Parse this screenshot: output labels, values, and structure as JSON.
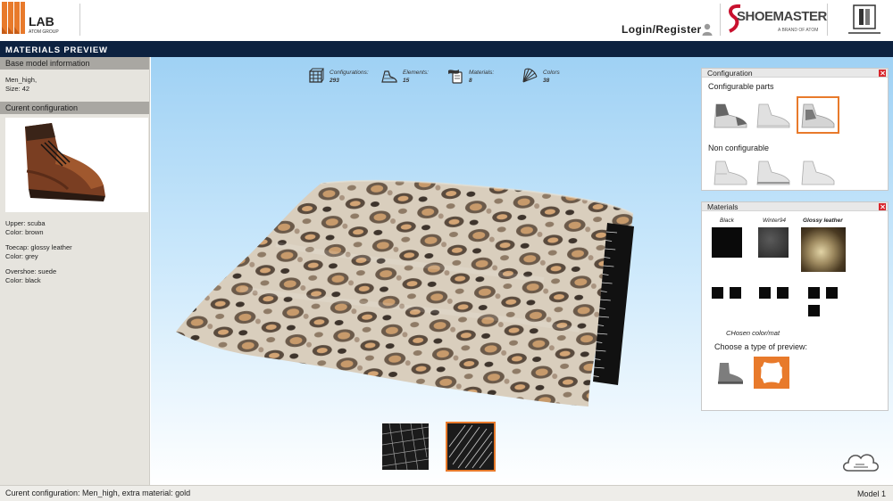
{
  "header": {
    "logo_lab": "LAB",
    "logo_sub": "ATOM GROUP",
    "login_label": "Login/Register",
    "shoemaster_text": "SHOEMASTER",
    "shoemaster_sub": "A BRAND OF ATOM"
  },
  "titlebar": {
    "title": "MATERIALS  PREVIEW"
  },
  "left": {
    "base_header": "Base model information",
    "model_name": "Men_high,",
    "model_size": "Size: 42",
    "current_header": "Curent configuration",
    "config": [
      {
        "line1": "Upper: scuba",
        "line2": "Color: brown"
      },
      {
        "line1": "Toecap: glossy leather",
        "line2": "Color: grey"
      },
      {
        "line1": "Overshoe: suede",
        "line2": "Color: black"
      }
    ]
  },
  "stats": [
    {
      "label": "Configurations:",
      "value": "293",
      "icon": "configurations-icon"
    },
    {
      "label": "Elements:",
      "value": "15",
      "icon": "shoe-elements-icon"
    },
    {
      "label": "Materials:",
      "value": "8",
      "icon": "materials-icon"
    },
    {
      "label": "Colors",
      "value": "38",
      "icon": "colors-fan-icon"
    }
  ],
  "configuration_panel": {
    "title": "Configuration",
    "configurable_label": "Configurable parts",
    "non_configurable_label": "Non configurable"
  },
  "materials_panel": {
    "title": "Materials",
    "swatches": [
      {
        "label": "Black"
      },
      {
        "label": "Winter94"
      },
      {
        "label": "Glossy leather"
      }
    ],
    "chosen_label": "CHosen color/mat",
    "preview_label": "Choose a type of preview:"
  },
  "status": {
    "left": "Curent configuration: Men_high, extra material: gold",
    "right": "Model 1"
  },
  "colors": {
    "accent": "#e87a2b",
    "navy": "#0d2240",
    "close": "#d8262c"
  }
}
